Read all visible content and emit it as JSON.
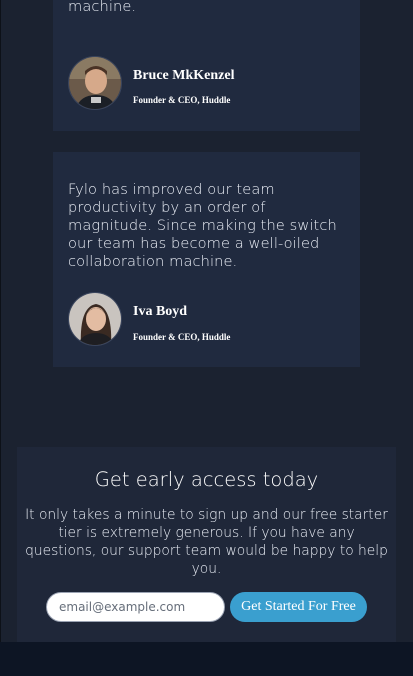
{
  "testimonials": [
    {
      "quote": "become a well-oiled collaboration machine.",
      "name": "Bruce MkKenzel",
      "role": "Founder & CEO, Huddle"
    },
    {
      "quote": "Fylo has improved our team productivity by an order of magnitude. Since making the switch our team has become a well-oiled collaboration machine.",
      "name": "Iva Boyd",
      "role": "Founder & CEO, Huddle"
    }
  ],
  "cta": {
    "title": "Get early access today",
    "description": "It only takes a minute to sign up and our free starter tier is extremely generous. If you have any questions, our support team would be happy to help you.",
    "email_placeholder": "email@example.com",
    "button_label": "Get Started For Free"
  },
  "colors": {
    "background": "#1b2230",
    "card": "#202a3f",
    "accent": "#3a9fcf",
    "footer": "#0d1524"
  }
}
